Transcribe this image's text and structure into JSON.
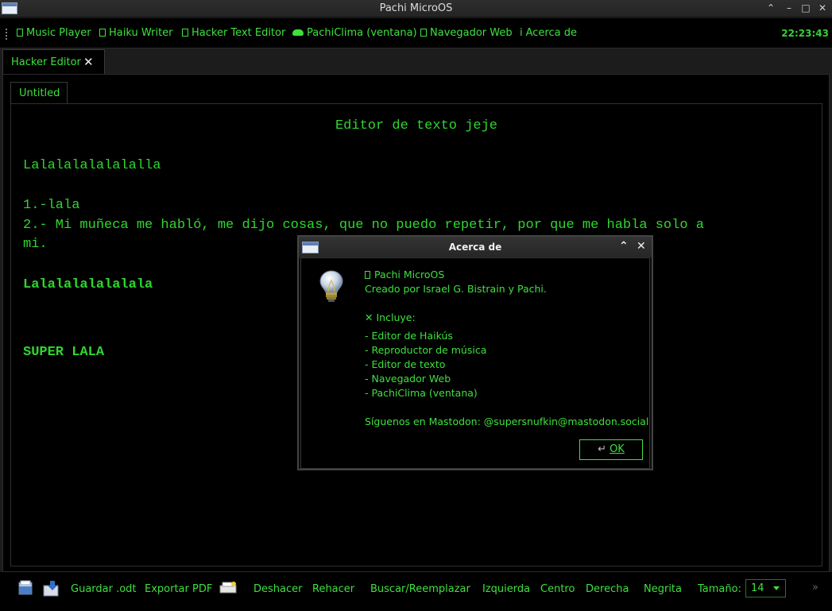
{
  "window": {
    "title": "Pachi MicroOS"
  },
  "menubar": {
    "items": [
      {
        "label": "Music Player"
      },
      {
        "label": "Haiku Writer"
      },
      {
        "label": "Hacker Text Editor"
      },
      {
        "label": "PachiClima (ventana)"
      },
      {
        "label": "Navegador Web"
      },
      {
        "label": "Acerca de"
      }
    ],
    "clock": "22:23:43"
  },
  "doc_tab": {
    "label": "Hacker Editor"
  },
  "editor_tab": {
    "label": "Untitled"
  },
  "editor": {
    "lines": [
      "Editor de texto jeje",
      "Lalalalalalalalla",
      "1.-lala",
      "2.- Mi muñeca me habló, me dijo cosas, que no puedo repetir, por que me habla solo a",
      "mi.",
      "Lalalalalalalala",
      "SUPER LALA"
    ]
  },
  "toolbar": {
    "save_odt": "Guardar .odt",
    "export_pdf": "Exportar PDF",
    "undo": "Deshacer",
    "redo": "Rehacer",
    "find_replace": "Buscar/Reemplazar",
    "left": "Izquierda",
    "center": "Centro",
    "right": "Derecha",
    "bold": "Negrita",
    "size_label": "Tamaño:",
    "size_value": "14",
    "overflow": "»"
  },
  "dialog": {
    "title": "Acerca de",
    "app_name": "Pachi MicroOS",
    "created_by": "Creado por Israel G. Bistrain y Pachi.",
    "includes_title": "Incluye:",
    "includes": [
      "- Editor de Haikús",
      "- Reproductor de música",
      "- Editor de texto",
      "- Navegador Web",
      "- PachiClima (ventana)"
    ],
    "follow": "Síguenos en Mastodon: @supersnufkin@mastodon.social",
    "ok_label": "OK"
  },
  "colors": {
    "accent": "#3ee03e",
    "background": "#000000"
  }
}
